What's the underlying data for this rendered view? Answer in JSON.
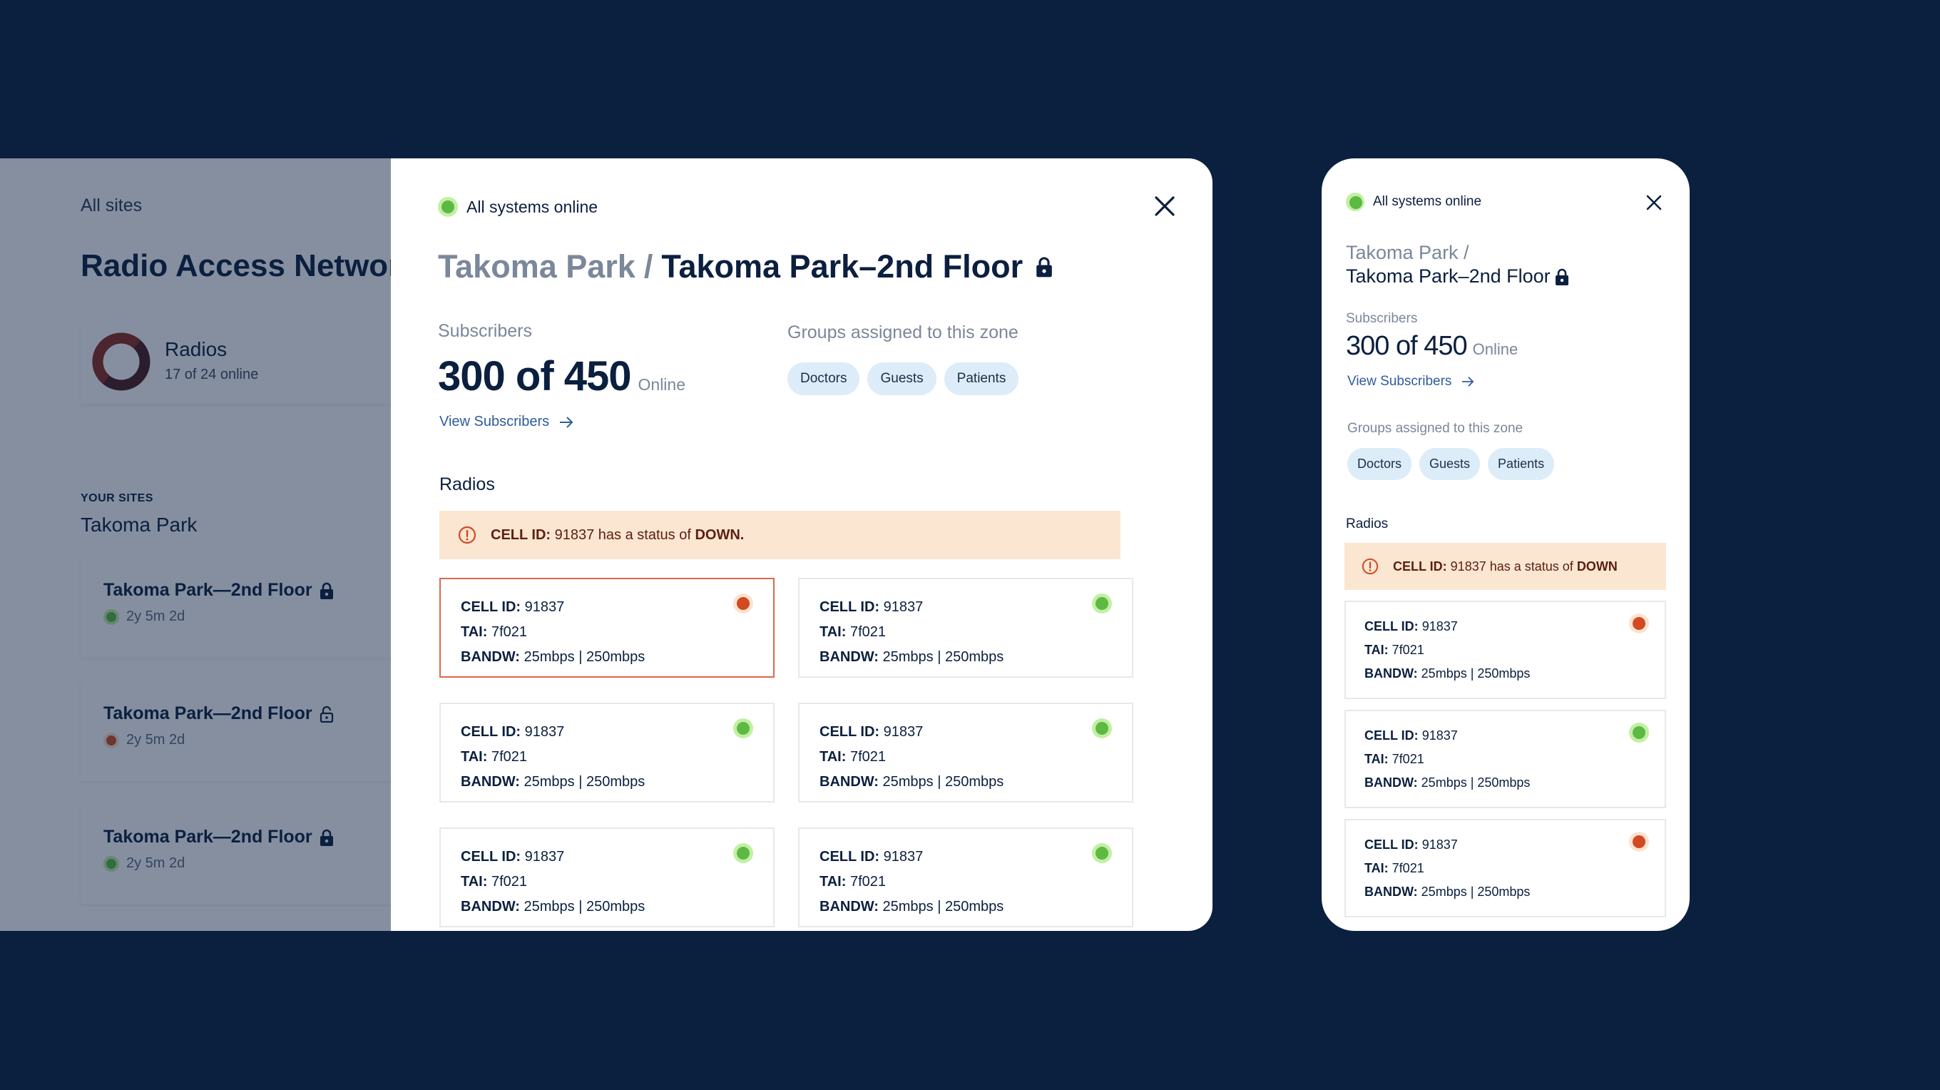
{
  "background_app": {
    "breadcrumb": "All sites",
    "title": "Radio Access Network",
    "radios_card": {
      "title": "Radios",
      "subtitle": "17 of 24 online",
      "online": 17,
      "total": 24
    },
    "section_label": "YOUR SITES",
    "section_title": "Takoma Park",
    "sites": [
      {
        "name": "Takoma Park—2nd Floor",
        "lock": "locked",
        "status": "online",
        "uptime": "2y 5m 2d"
      },
      {
        "name": "Takoma Park—2nd Floor",
        "lock": "unlocked",
        "status": "down",
        "uptime": "2y 5m 2d"
      },
      {
        "name": "Takoma Park—2nd Floor",
        "lock": "locked",
        "status": "online",
        "uptime": "2y 5m 2d"
      }
    ]
  },
  "modal": {
    "status_text": "All systems online",
    "close_icon": "close-icon",
    "breadcrumb_parent": "Takoma Park",
    "breadcrumb_separator": "/",
    "title": "Takoma Park–2nd Floor",
    "subscribers": {
      "label": "Subscribers",
      "value": "300 of 450",
      "suffix": "Online",
      "link": "View Subscribers"
    },
    "groups": {
      "label": "Groups assigned to this zone",
      "chips": [
        "Doctors",
        "Guests",
        "Patients"
      ]
    },
    "radios_title": "Radios",
    "alert": {
      "label": "CELL ID:",
      "text": " 91837 has a status of ",
      "status": "DOWN."
    },
    "radios": [
      {
        "cell_label": "CELL ID:",
        "cell_id": "91837",
        "tai_label": "TAI:",
        "tai": "7f021",
        "bandw_label": "BANDW:",
        "bandw": "25mbps | 250mbps",
        "status": "down"
      },
      {
        "cell_label": "CELL ID:",
        "cell_id": "91837",
        "tai_label": "TAI:",
        "tai": "7f021",
        "bandw_label": "BANDW:",
        "bandw": "25mbps | 250mbps",
        "status": "online"
      },
      {
        "cell_label": "CELL ID:",
        "cell_id": "91837",
        "tai_label": "TAI:",
        "tai": "7f021",
        "bandw_label": "BANDW:",
        "bandw": "25mbps | 250mbps",
        "status": "online"
      },
      {
        "cell_label": "CELL ID:",
        "cell_id": "91837",
        "tai_label": "TAI:",
        "tai": "7f021",
        "bandw_label": "BANDW:",
        "bandw": "25mbps | 250mbps",
        "status": "online"
      },
      {
        "cell_label": "CELL ID:",
        "cell_id": "91837",
        "tai_label": "TAI:",
        "tai": "7f021",
        "bandw_label": "BANDW:",
        "bandw": "25mbps | 250mbps",
        "status": "online"
      },
      {
        "cell_label": "CELL ID:",
        "cell_id": "91837",
        "tai_label": "TAI:",
        "tai": "7f021",
        "bandw_label": "BANDW:",
        "bandw": "25mbps | 250mbps",
        "status": "online"
      }
    ]
  },
  "mobile": {
    "status_text": "All systems online",
    "breadcrumb_parent": "Takoma Park /",
    "title": "Takoma Park–2nd Floor",
    "subscribers": {
      "label": "Subscribers",
      "value": "300 of 450",
      "suffix": "Online",
      "link": "View Subscribers"
    },
    "groups": {
      "label": "Groups assigned to this zone",
      "chips": [
        "Doctors",
        "Guests",
        "Patients"
      ]
    },
    "radios_title": "Radios",
    "alert": {
      "label": "CELL ID:",
      "text": " 91837 has a status of ",
      "status": "DOWN"
    },
    "radios": [
      {
        "cell_label": "CELL ID:",
        "cell_id": "91837",
        "tai_label": "TAI:",
        "tai": "7f021",
        "bandw_label": "BANDW:",
        "bandw": "25mbps | 250mbps",
        "status": "down"
      },
      {
        "cell_label": "CELL ID:",
        "cell_id": "91837",
        "tai_label": "TAI:",
        "tai": "7f021",
        "bandw_label": "BANDW:",
        "bandw": "25mbps | 250mbps",
        "status": "online"
      },
      {
        "cell_label": "CELL ID:",
        "cell_id": "91837",
        "tai_label": "TAI:",
        "tai": "7f021",
        "bandw_label": "BANDW:",
        "bandw": "25mbps | 250mbps",
        "status": "down"
      }
    ]
  },
  "colors": {
    "page_bg": "#0b1f3f",
    "online": "#5db944",
    "online_halo": "#c2f0a3",
    "down": "#d24a22",
    "down_halo": "#fbe3d0",
    "alert_bg": "#fbe6d1",
    "chip_bg": "#dcecf9",
    "link": "#2f5c9a"
  }
}
